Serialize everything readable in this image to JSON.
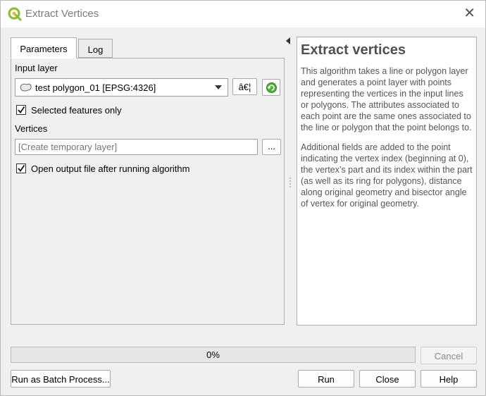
{
  "window": {
    "title": "Extract Vertices"
  },
  "tabs": [
    {
      "label": "Parameters"
    },
    {
      "label": "Log"
    }
  ],
  "parameters": {
    "input_layer_label": "Input layer",
    "input_layer_value": "test polygon_01 [EPSG:4326]",
    "ellipsis_button_label": "â€¦",
    "selected_features_label": "Selected features only",
    "selected_features_checked": true,
    "vertices_label": "Vertices",
    "vertices_placeholder": "[Create temporary layer]",
    "vertices_browse_label": "...",
    "open_output_label": "Open output file after running algorithm",
    "open_output_checked": true
  },
  "help": {
    "title": "Extract vertices",
    "paragraph1": "This algorithm takes a line or polygon layer and generates a point layer with points representing the vertices in the input lines or polygons. The attributes associated to each point are the same ones associated to the line or polygon that the point belongs to.",
    "paragraph2": "Additional fields are added to the point indicating the vertex index (beginning at 0), the vertex’s part and its index within the part (as well as its ring for polygons), distance along original geometry and bisector angle of vertex for original geometry."
  },
  "progress": {
    "value": 0,
    "text": "0%"
  },
  "buttons": {
    "cancel": "Cancel",
    "batch": "Run as Batch Process...",
    "run": "Run",
    "close": "Close",
    "help": "Help"
  },
  "colors": {
    "logo_green": "#8fbc3c",
    "logo_yellow": "#f2b924",
    "refresh_green": "#4caf3c"
  }
}
